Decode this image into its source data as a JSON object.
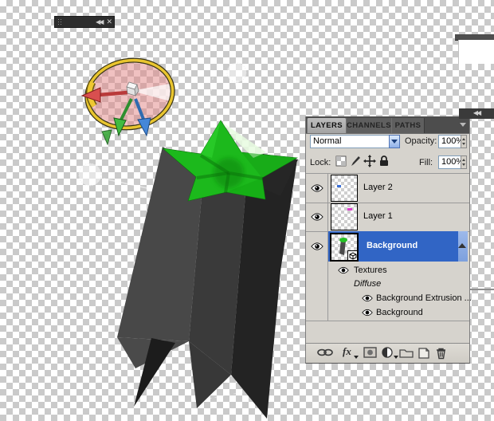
{
  "floating_bar": {
    "collapse_icon": "◀◀",
    "close_icon": "✕"
  },
  "dock_strip": {
    "collapse_icon": "◀◀"
  },
  "layers_panel": {
    "tabs": [
      {
        "label": "LAYERS"
      },
      {
        "label": "CHANNELS"
      },
      {
        "label": "PATHS"
      }
    ],
    "blend_mode": {
      "value": "Normal"
    },
    "opacity": {
      "label": "Opacity:",
      "value": "100%"
    },
    "lock": {
      "label": "Lock:"
    },
    "fill": {
      "label": "Fill:",
      "value": "100%"
    },
    "layers": [
      {
        "name": "Layer 2",
        "visible": true,
        "selected": false
      },
      {
        "name": "Layer 1",
        "visible": true,
        "selected": false
      },
      {
        "name": "Background",
        "visible": true,
        "selected": true,
        "is_3d": true
      }
    ],
    "textures": {
      "header": "Textures",
      "map_type": "Diffuse",
      "items": [
        {
          "name": "Background Extrusion ..."
        },
        {
          "name": "Background"
        }
      ]
    },
    "footer": {
      "fx_label": "fx"
    }
  },
  "canvas": {
    "object": "3d-extruded-star",
    "colors": {
      "star_green": "#1cb91c",
      "extrusion_gray": "#3a3a3a",
      "selection_blue": "#3165c5",
      "axis_x_red": "#d94f4f",
      "axis_y_green": "#41bb41",
      "axis_z_blue": "#4587d8",
      "ring_yellow": "#e9c52f"
    }
  }
}
